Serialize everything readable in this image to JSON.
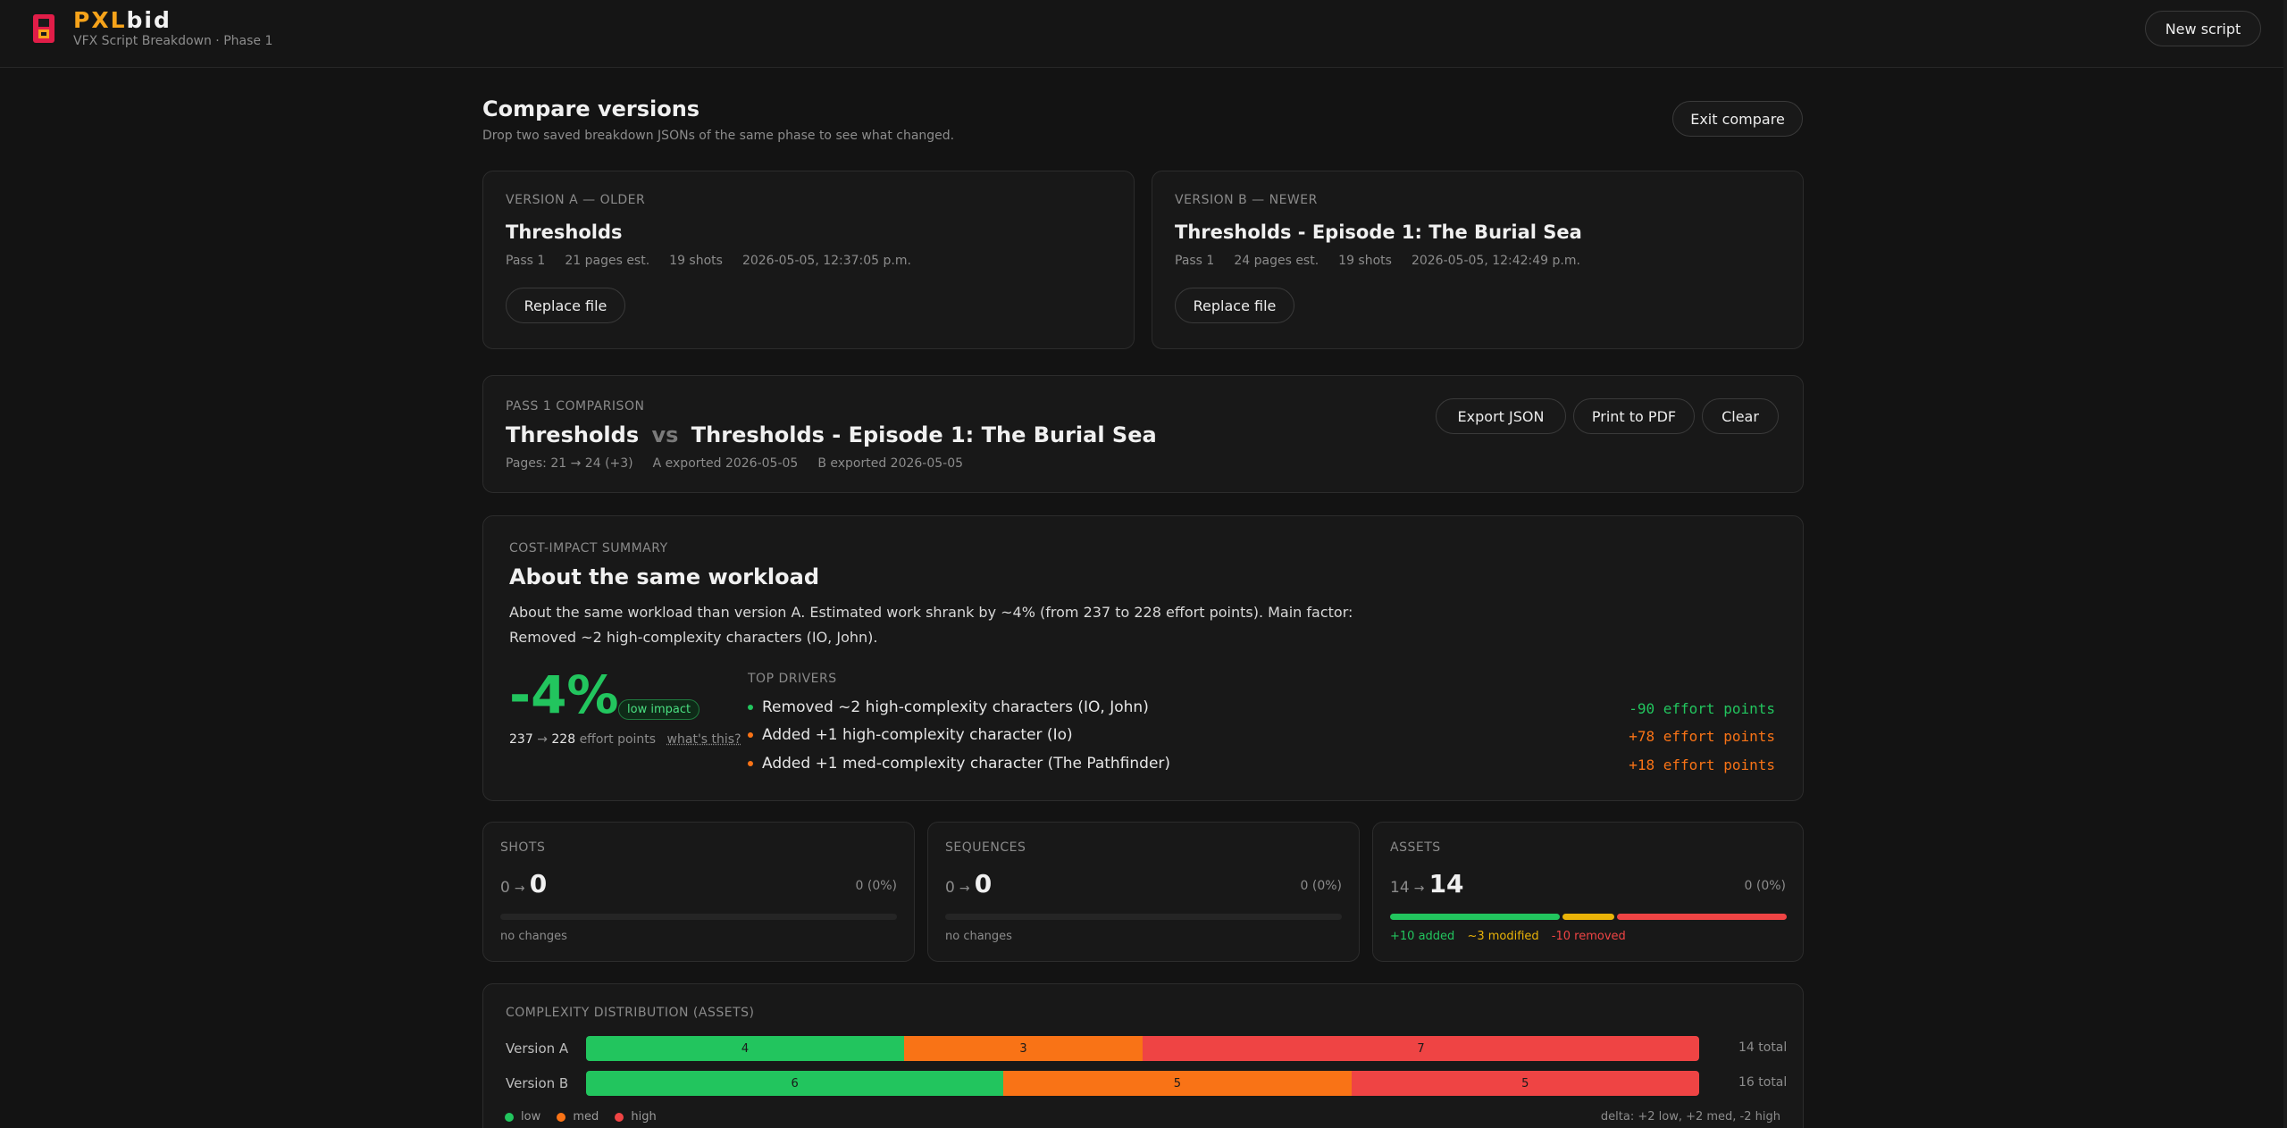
{
  "header": {
    "brand_a": "PXL",
    "brand_b": "bid",
    "subtitle": "VFX Script Breakdown · Phase 1",
    "new_script_label": "New script"
  },
  "page": {
    "title": "Compare versions",
    "subtitle": "Drop two saved breakdown JSONs of the same phase to see what changed.",
    "exit_label": "Exit compare"
  },
  "version_a": {
    "eyebrow": "VERSION A — OLDER",
    "title": "Thresholds",
    "pass": "Pass 1",
    "pages": "21 pages est.",
    "shots": "19 shots",
    "timestamp": "2026-05-05, 12:37:05 p.m.",
    "replace_label": "Replace file"
  },
  "version_b": {
    "eyebrow": "VERSION B — NEWER",
    "title": "Thresholds - Episode 1: The Burial Sea",
    "pass": "Pass 1",
    "pages": "24 pages est.",
    "shots": "19 shots",
    "timestamp": "2026-05-05, 12:42:49 p.m.",
    "replace_label": "Replace file"
  },
  "comparison": {
    "eyebrow": "PASS 1 COMPARISON",
    "title_a": "Thresholds",
    "vs": "vs",
    "title_b": "Thresholds - Episode 1: The Burial Sea",
    "pages": "Pages: 21 → 24 (+3)",
    "a_exported": "A exported 2026-05-05",
    "b_exported": "B exported 2026-05-05",
    "export_json_label": "Export JSON",
    "print_pdf_label": "Print to PDF",
    "clear_label": "Clear"
  },
  "cost_impact": {
    "eyebrow": "COST-IMPACT SUMMARY",
    "headline": "About the same workload",
    "description_line1": "About the same workload than version A. Estimated work shrank by ~4% (from 237 to 228 effort points). Main factor:",
    "description_line2": "Removed ~2 high-complexity characters (IO, John).",
    "percent": "-4%",
    "badge": "low impact",
    "points_from": "237",
    "arrow": "→",
    "points_to": "228",
    "points_label": "effort points",
    "whats_this": "what's this?",
    "drivers_eyebrow": "TOP DRIVERS",
    "drivers": [
      {
        "text": "Removed ~2 high-complexity characters (IO, John)",
        "value": "-90 effort points",
        "color": "#22c55e"
      },
      {
        "text": "Added +1 high-complexity character (Io)",
        "value": "+78 effort points",
        "color": "#f97316"
      },
      {
        "text": "Added +1 med-complexity character (The Pathfinder)",
        "value": "+18 effort points",
        "color": "#f97316"
      }
    ]
  },
  "stats": {
    "shots": {
      "label": "SHOTS",
      "from": "0",
      "arrow": "→",
      "to": "0",
      "change": "0 (0%)",
      "note": "no changes"
    },
    "sequences": {
      "label": "SEQUENCES",
      "from": "0",
      "arrow": "→",
      "to": "0",
      "change": "0 (0%)",
      "note": "no changes"
    },
    "assets": {
      "label": "ASSETS",
      "from": "14",
      "arrow": "→",
      "to": "14",
      "change": "0 (0%)",
      "added": "+10 added",
      "modified": "~3 modified",
      "removed": "-10 removed",
      "added_count": 10,
      "modified_count": 3,
      "removed_count": 10,
      "colors": {
        "added": "#22c55e",
        "modified": "#eab308",
        "removed": "#ef4444"
      }
    }
  },
  "complexity": {
    "eyebrow": "COMPLEXITY DISTRIBUTION (ASSETS)",
    "rows": [
      {
        "label": "Version A",
        "low": 4,
        "med": 3,
        "high": 7,
        "total": "14 total"
      },
      {
        "label": "Version B",
        "low": 6,
        "med": 5,
        "high": 5,
        "total": "16 total"
      }
    ],
    "legend": {
      "low": "low",
      "med": "med",
      "high": "high"
    },
    "delta": "delta: +2 low, +2 med, -2 high",
    "colors": {
      "low": "#22c55e",
      "med": "#f97316",
      "high": "#ef4444"
    }
  }
}
